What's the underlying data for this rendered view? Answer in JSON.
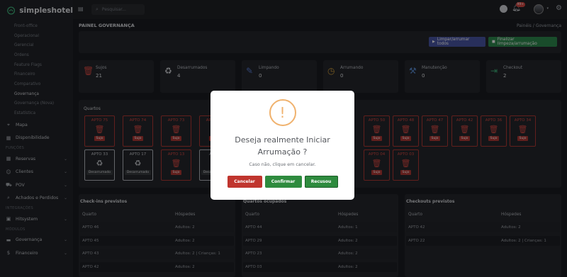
{
  "brand": {
    "name": "simpleshotel"
  },
  "topbar": {
    "search_placeholder": "Pesquisar...",
    "notif_count": "99+"
  },
  "sidebar": {
    "sub_items": [
      "Front-office",
      "Operacional",
      "Gerencial",
      "Ordens",
      "Feature Flags",
      "Financeiro",
      "Comparativo",
      "Governança",
      "Governança (Nova)",
      "Estatística"
    ],
    "active_index": 7,
    "items_top": [
      {
        "label": "Mapa",
        "icon": "map-icon"
      },
      {
        "label": "Disponibilidade",
        "icon": "calendar-icon"
      }
    ],
    "section_funcoes": "FUNÇÕES",
    "items_funcoes": [
      {
        "label": "Reservas",
        "icon": "calendar-icon"
      },
      {
        "label": "Clientes",
        "icon": "users-icon"
      },
      {
        "label": "POV",
        "icon": "cart-icon"
      },
      {
        "label": "Achados e Perdidos",
        "icon": "search-icon"
      }
    ],
    "section_integracoes": "INTEGRAÇÕES",
    "items_integracoes": [
      {
        "label": "Hitsystem",
        "icon": "box-icon"
      }
    ],
    "section_modulos": "MÓDULOS",
    "items_modulos": [
      {
        "label": "Governança",
        "icon": "bed-icon"
      },
      {
        "label": "Financeiro",
        "icon": "money-icon"
      }
    ]
  },
  "page": {
    "title": "PAINEL GOVERNANÇA",
    "breadcrumb_home": "Painéis",
    "breadcrumb_sep": "/",
    "breadcrumb_current": "Governança"
  },
  "actions": {
    "clean_all": "Limpar/arrumar todos",
    "finish": "Finalizar limpeza/arrumação"
  },
  "colors": {
    "dirty": "#b23a35",
    "primary": "#4a56a6",
    "success": "#2f8a4f",
    "warning": "#f0b26e"
  },
  "stats": [
    {
      "label": "Sujos",
      "value": "21",
      "icon": "trash-icon",
      "color": "#d84a44"
    },
    {
      "label": "Desarrumados",
      "value": "4",
      "icon": "recycle-icon",
      "color": "#d3d5da"
    },
    {
      "label": "Limpando",
      "value": "0",
      "icon": "brush-icon",
      "color": "#5b7fd6"
    },
    {
      "label": "Arrumando",
      "value": "0",
      "icon": "clock-icon",
      "color": "#d8a23c"
    },
    {
      "label": "Manutenção",
      "value": "0",
      "icon": "wrench-icon",
      "color": "#5b8fd6"
    },
    {
      "label": "Checkout",
      "value": "2",
      "icon": "exit-icon",
      "color": "#3fb37a"
    }
  ],
  "rooms": {
    "title": "Quartos",
    "row1": [
      {
        "name": "APTO 75",
        "status": "Sujo"
      },
      {
        "name": "APTO 74",
        "status": "Sujo"
      },
      {
        "name": "APTO 73",
        "status": "Sujo"
      },
      {
        "name": "APTO 71",
        "status": "Sujo"
      },
      {
        "name": "APTO 50",
        "status": "Sujo"
      },
      {
        "name": "APTO 48",
        "status": "Sujo"
      },
      {
        "name": "APTO 47",
        "status": "Sujo"
      },
      {
        "name": "APTO 42",
        "status": "Sujo"
      },
      {
        "name": "APTO 36",
        "status": "Sujo"
      },
      {
        "name": "APTO 34",
        "status": "Sujo"
      }
    ],
    "row2": [
      {
        "name": "APTO 33",
        "status": "Desarrumado",
        "type": "mess"
      },
      {
        "name": "APTO 17",
        "status": "Desarrumado",
        "type": "mess"
      },
      {
        "name": "APTO 13",
        "status": "Sujo",
        "type": "dirty"
      },
      {
        "name": "APTO",
        "status": "Desarrumado",
        "type": "mess"
      },
      {
        "name": "APTO 04",
        "status": "Sujo",
        "type": "dirty"
      },
      {
        "name": "APTO 03",
        "status": "Sujo",
        "type": "dirty"
      }
    ]
  },
  "checkins": {
    "title": "Check-ins previstos",
    "col1": "Quarto",
    "col2": "Hóspedes",
    "rows": [
      [
        "APTO 46",
        "Adultos: 2"
      ],
      [
        "APTO 45",
        "Adultos: 2"
      ],
      [
        "APTO 43",
        "Adultos: 2 | Crianças: 1"
      ],
      [
        "APTO 42",
        "Adultos: 2"
      ]
    ]
  },
  "occupied": {
    "title": "Quartos ocupados",
    "col1": "Quarto",
    "col2": "Hóspedes",
    "rows": [
      [
        "APTO 44",
        "Adultos: 1"
      ],
      [
        "APTO 29",
        "Adultos: 2"
      ],
      [
        "APTO 23",
        "Adultos: 2"
      ],
      [
        "APTO 03",
        "Adultos: 2"
      ]
    ]
  },
  "checkouts": {
    "title": "Checkouts previstos",
    "col1": "Quarto",
    "col2": "Hóspedes",
    "rows": [
      [
        "APTO 42",
        "Adultos: 2"
      ],
      [
        "APTO 22",
        "Adultos: 2 | Crianças: 1"
      ]
    ]
  },
  "modal": {
    "icon": "!",
    "title": "Deseja realmente Iniciar Arrumação ?",
    "text": "Caso não, clique em cancelar.",
    "cancel": "Cancelar",
    "confirm": "Confirmar",
    "refuse": "Recusou"
  }
}
